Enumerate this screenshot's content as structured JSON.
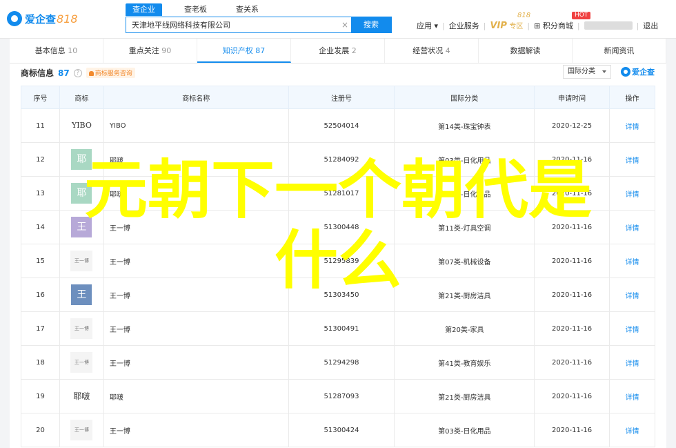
{
  "header": {
    "logo_text": "爱企查",
    "logo_num": "818",
    "search_tabs": [
      "查企业",
      "查老板",
      "查关系"
    ],
    "search_value": "天津地平线网络科技有限公司",
    "search_button": "搜索",
    "nav": {
      "app": "应用",
      "service": "企业服务",
      "vip": "VIP",
      "vip_zone": "专区",
      "vip_818": "818",
      "points": "积分商城",
      "hot": "HOT",
      "logout": "退出"
    }
  },
  "tabs": [
    {
      "label": "基本信息",
      "count": "10"
    },
    {
      "label": "重点关注",
      "count": "90"
    },
    {
      "label": "知识产权",
      "count": "87"
    },
    {
      "label": "企业发展",
      "count": "2"
    },
    {
      "label": "经营状况",
      "count": "4"
    },
    {
      "label": "数据解读",
      "count": ""
    },
    {
      "label": "新闻资讯",
      "count": ""
    }
  ],
  "section": {
    "title": "商标信息",
    "count": "87",
    "advice": "商标服务咨询",
    "filter": "国际分类",
    "brand": "爱企查"
  },
  "columns": [
    "序号",
    "商标",
    "商标名称",
    "注册号",
    "国际分类",
    "申请时间",
    "操作"
  ],
  "rows": [
    {
      "no": "11",
      "logo": "YIBO",
      "name": "YIBO",
      "reg": "52504014",
      "cls": "第14类-珠宝钟表",
      "date": "2020-12-25",
      "op": "详情"
    },
    {
      "no": "12",
      "logo": "耶",
      "name": "耶啵",
      "reg": "51284092",
      "cls": "第03类-日化用品",
      "date": "2020-11-16",
      "op": "详情"
    },
    {
      "no": "13",
      "logo": "耶",
      "name": "耶啵",
      "reg": "51281017",
      "cls": "第03类-日化用品",
      "date": "2020-11-16",
      "op": "详情"
    },
    {
      "no": "14",
      "logo": "王",
      "name": "王一博",
      "reg": "51300448",
      "cls": "第11类-灯具空调",
      "date": "2020-11-16",
      "op": "详情"
    },
    {
      "no": "15",
      "logo": "王一博",
      "name": "王一博",
      "reg": "51295839",
      "cls": "第07类-机械设备",
      "date": "2020-11-16",
      "op": "详情"
    },
    {
      "no": "16",
      "logo": "王",
      "name": "王一博",
      "reg": "51303450",
      "cls": "第21类-厨房洁具",
      "date": "2020-11-16",
      "op": "详情"
    },
    {
      "no": "17",
      "logo": "王一博",
      "name": "王一博",
      "reg": "51300491",
      "cls": "第20类-家具",
      "date": "2020-11-16",
      "op": "详情"
    },
    {
      "no": "18",
      "logo": "王一博",
      "name": "王一博",
      "reg": "51294298",
      "cls": "第41类-教育娱乐",
      "date": "2020-11-16",
      "op": "详情"
    },
    {
      "no": "19",
      "logo": "耶啵",
      "name": "耶啵",
      "reg": "51287093",
      "cls": "第21类-厨房洁具",
      "date": "2020-11-16",
      "op": "详情"
    },
    {
      "no": "20",
      "logo": "王一博",
      "name": "王一博",
      "reg": "51300424",
      "cls": "第03类-日化用品",
      "date": "2020-11-16",
      "op": "详情"
    }
  ],
  "overlay": {
    "line1": "元朝下一个朝代是",
    "line2": "什么"
  },
  "colors": {
    "accent": "#128bed",
    "overlay": "#ffff00",
    "vip": "#e2b04a"
  }
}
